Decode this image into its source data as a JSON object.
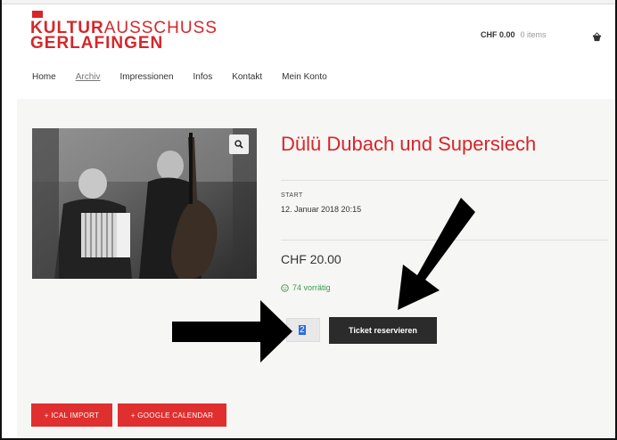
{
  "brand": {
    "line1_strong": "KULTUR",
    "line1_light": "AUSSCHUSS",
    "line2": "GERLAFINGEN",
    "color": "#d6262a"
  },
  "cart": {
    "amount": "CHF 0.00",
    "items": "0 items",
    "icon": "basket-icon"
  },
  "nav": {
    "items": [
      "Home",
      "Archiv",
      "Impressionen",
      "Infos",
      "Kontakt",
      "Mein Konto"
    ],
    "active": "Archiv"
  },
  "product": {
    "title": "Dülü Dubach und Supersiech",
    "start_label": "START",
    "start_value": "12. Januar 2018 20:15",
    "price": "CHF 20.00",
    "stock": "74 vorrätig",
    "stock_color": "#3a9b4a",
    "quantity": "2",
    "reserve_label": "Ticket reservieren",
    "zoom_icon": "zoom-icon",
    "image": "band-photo"
  },
  "actions": {
    "ical": "+ ICAL IMPORT",
    "gcal": "+ GOOGLE CALENDAR"
  }
}
